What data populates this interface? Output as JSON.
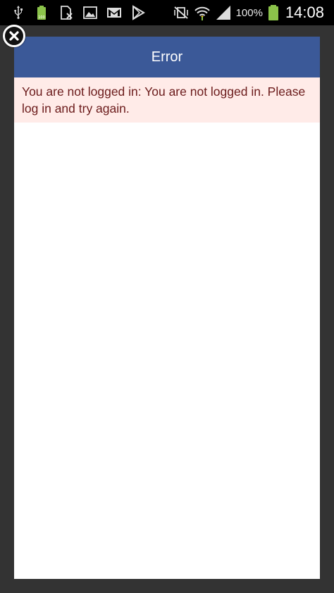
{
  "status_bar": {
    "battery_percent": "100%",
    "time": "14:08",
    "left_icons": [
      "usb-icon",
      "battery-small-icon",
      "sim-error-icon",
      "gallery-icon",
      "gmail-icon",
      "play-store-icon"
    ],
    "right_icons": [
      "mute-vibrate-icon",
      "wifi-icon",
      "signal-icon",
      "battery-icon"
    ],
    "colors": {
      "battery_green": "#8bc34a",
      "background": "#000000"
    }
  },
  "dialog": {
    "title": "Error",
    "message": "You are not logged in: You are not logged in. Please log in and try again.",
    "colors": {
      "header": "#3b5998",
      "banner_background": "#ffebe8",
      "banner_text": "#6b1b1b"
    }
  },
  "close_button": {
    "icon": "close-icon"
  }
}
